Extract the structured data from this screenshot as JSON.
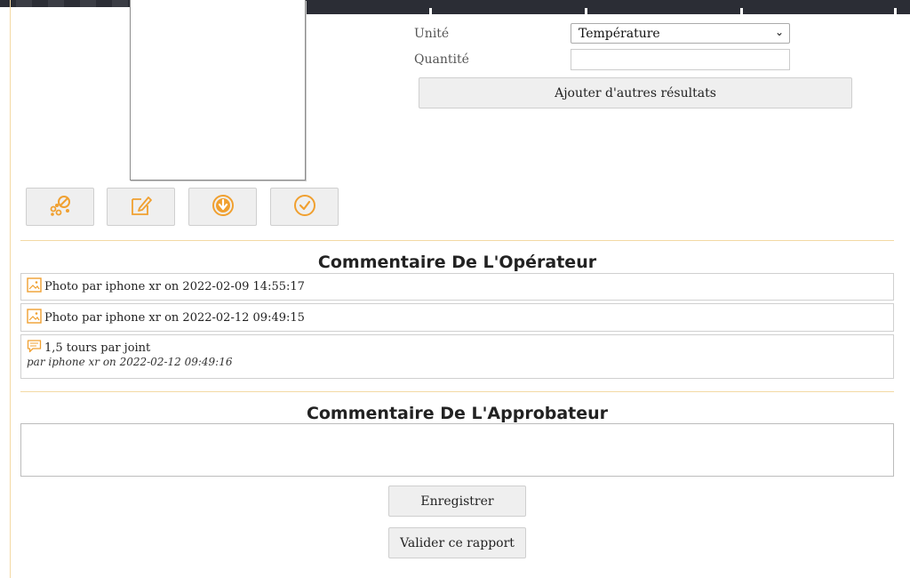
{
  "form": {
    "unit_label": "Unité",
    "unit_value": "Température",
    "quantity_label": "Quantité",
    "quantity_value": "",
    "add_results_label": "Ajouter d'autres résultats"
  },
  "toolbar": {
    "icons": [
      "photos-icon",
      "edit-icon",
      "download-icon",
      "check-circle-icon"
    ]
  },
  "operator": {
    "title": "Commentaire De L'Opérateur",
    "items": [
      {
        "type": "photo",
        "text": "Photo par iphone xr on 2022-02-09 14:55:17"
      },
      {
        "type": "photo",
        "text": "Photo par iphone xr on 2022-02-12 09:49:15"
      },
      {
        "type": "comment",
        "text": "1,5 tours par joint",
        "meta": "par iphone xr on 2022-02-12 09:49:16"
      }
    ]
  },
  "approver": {
    "title": "Commentaire De L'Approbateur",
    "value": ""
  },
  "actions": {
    "save_label": "Enregistrer",
    "validate_label": "Valider ce rapport"
  },
  "colors": {
    "accent": "#f0a030",
    "divider": "#f3d9a4",
    "topbar": "#2b2d35"
  }
}
